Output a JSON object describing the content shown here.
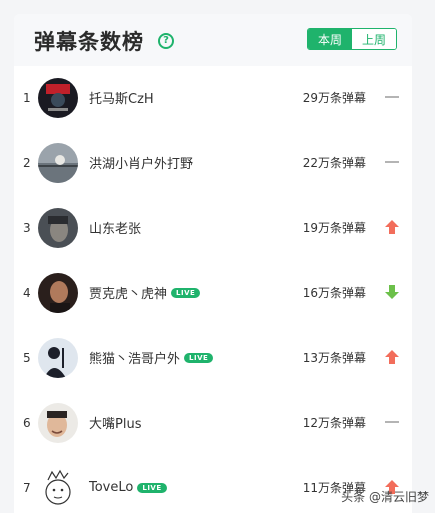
{
  "header": {
    "title": "弹幕条数榜",
    "help_icon": "question-circle-icon",
    "tabs": [
      {
        "label": "本周",
        "active": true
      },
      {
        "label": "上周",
        "active": false
      }
    ]
  },
  "rows": [
    {
      "rank": "1",
      "name": "托马斯CzH",
      "live": false,
      "count": "29万条弹幕",
      "trend": "flat"
    },
    {
      "rank": "2",
      "name": "洪湖小肖户外打野",
      "live": false,
      "count": "22万条弹幕",
      "trend": "flat"
    },
    {
      "rank": "3",
      "name": "山东老张",
      "live": false,
      "count": "19万条弹幕",
      "trend": "up"
    },
    {
      "rank": "4",
      "name": "贾克虎丶虎神",
      "live": true,
      "count": "16万条弹幕",
      "trend": "down"
    },
    {
      "rank": "5",
      "name": "熊猫丶浩哥户外",
      "live": true,
      "count": "13万条弹幕",
      "trend": "up"
    },
    {
      "rank": "6",
      "name": "大嘴Plus",
      "live": false,
      "count": "12万条弹幕",
      "trend": "flat"
    },
    {
      "rank": "7",
      "name": "ToveLo",
      "live": true,
      "count": "11万条弹幕",
      "trend": "up"
    }
  ],
  "live_label": "LIVE",
  "colors": {
    "accent": "#1fb36c",
    "up": "#f26d5b",
    "down": "#6cc04a",
    "flat": "#b4b4b4"
  },
  "watermark": "头条 @清云旧梦"
}
